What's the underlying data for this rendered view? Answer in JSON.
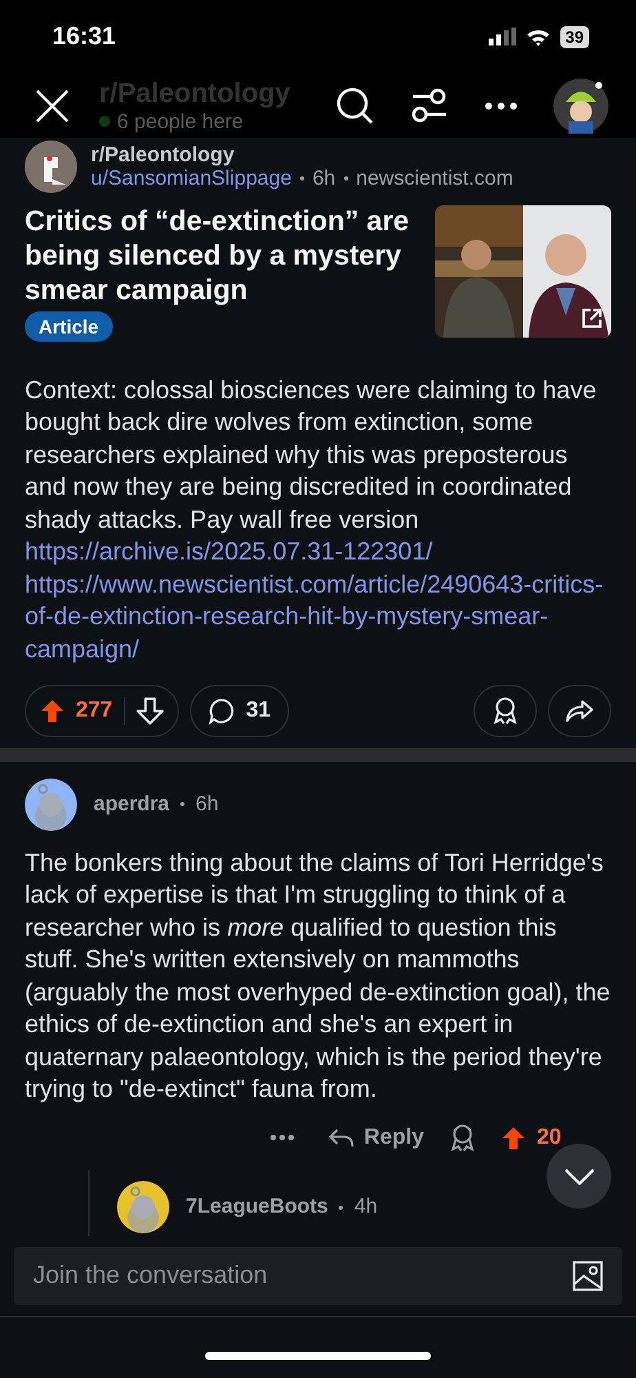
{
  "status_bar": {
    "time": "16:31",
    "battery": "39"
  },
  "header": {
    "title": "r/Paleontology",
    "presence": "6 people here"
  },
  "post": {
    "subreddit": "r/Paleontology",
    "author": "u/SansomianSlippage",
    "time": "6h",
    "domain": "newscientist.com",
    "title": "Critics of “de-extinction” are being silenced by a mystery smear campaign",
    "flair": "Article",
    "body": "Context: colossal biosciences were claiming to have bought back dire wolves from extinction, some researchers explained why this was preposterous and now they are being discredited in coordinated shady attacks. Pay wall free version",
    "links": [
      "https://archive.is/2025.07.31-122301/",
      "https://www.newscientist.com/article/2490643-critics-of-de-extinction-research-hit-by-mystery-smear-campaign/"
    ],
    "score": "277",
    "upvoted": true,
    "comments": "31"
  },
  "comments": [
    {
      "author": "aperdra",
      "time": "6h",
      "color": "#8fb4f8",
      "text": "The bonkers thing about the claims of Tori Herridge's lack of expertise is that I'm struggling to think of a researcher who is *more* qualified to question this stuff. She's written extensively on mammoths (arguably the most overhyped de-extinction goal), the ethics of de-extinction and she's an expert in quaternary palaeontology, which is the period they're trying to \"de-extinct\" fauna from.",
      "reply": "Reply",
      "score": "20",
      "upvoted": true
    },
    {
      "author": "7LeagueBoots",
      "time": "4h",
      "color": "#e8c22c"
    }
  ],
  "composer": {
    "placeholder": "Join the conversation"
  }
}
